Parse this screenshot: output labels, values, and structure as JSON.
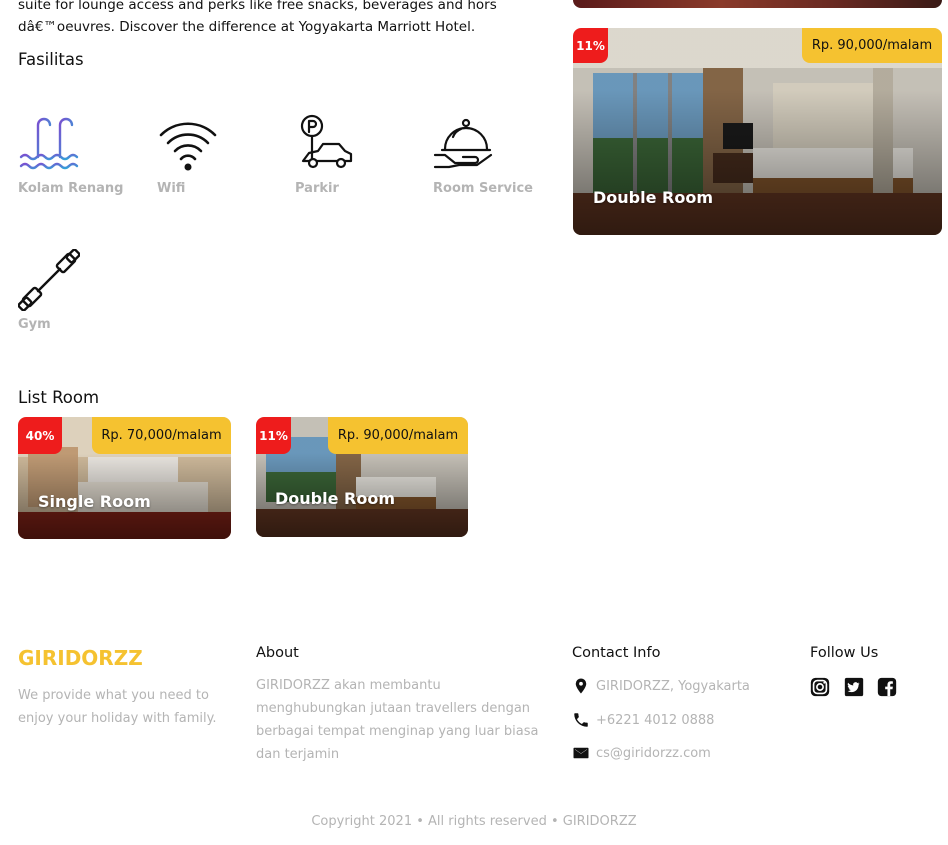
{
  "hotel": {
    "description": "suite for lounge access and perks like free snacks, beverages and hors dâ€™oeuvres. Discover the difference at Yogyakarta Marriott Hotel."
  },
  "facilities": {
    "title": "Fasilitas",
    "items": [
      {
        "label": "Kolam Renang",
        "icon": "swimming-pool-icon"
      },
      {
        "label": "Wifi",
        "icon": "wifi-icon"
      },
      {
        "label": "Parkir",
        "icon": "parking-icon"
      },
      {
        "label": "Room Service",
        "icon": "room-service-icon"
      },
      {
        "label": "Gym",
        "icon": "dumbbell-icon"
      }
    ]
  },
  "featured_room": {
    "discount": "11%",
    "price": "Rp. 90,000/malam",
    "name": "Double Room"
  },
  "list_room": {
    "title": "List Room",
    "rooms": [
      {
        "discount": "40%",
        "price": "Rp. 70,000/malam",
        "name": "Single Room"
      },
      {
        "discount": "11%",
        "price": "Rp. 90,000/malam",
        "name": "Double Room"
      }
    ]
  },
  "footer": {
    "brand": "GIRIDORZZ",
    "tagline": "We provide what you need to enjoy your holiday with family.",
    "about": {
      "title": "About",
      "text": "GIRIDORZZ akan membantu menghubungkan jutaan travellers dengan berbagai tempat menginap yang luar biasa dan terjamin"
    },
    "contact": {
      "title": "Contact Info",
      "address": "GIRIDORZZ, Yogyakarta",
      "phone": "+6221 4012 0888",
      "email": "cs@giridorzz.com"
    },
    "follow": {
      "title": "Follow Us",
      "icons": [
        "instagram-icon",
        "twitter-icon",
        "facebook-icon"
      ]
    },
    "copyright": "Copyright 2021 • All rights reserved • GIRIDORZZ"
  },
  "colors": {
    "accent": "#f5c230",
    "discount": "#ee1c1c",
    "muted_text": "#b4b4b4"
  }
}
